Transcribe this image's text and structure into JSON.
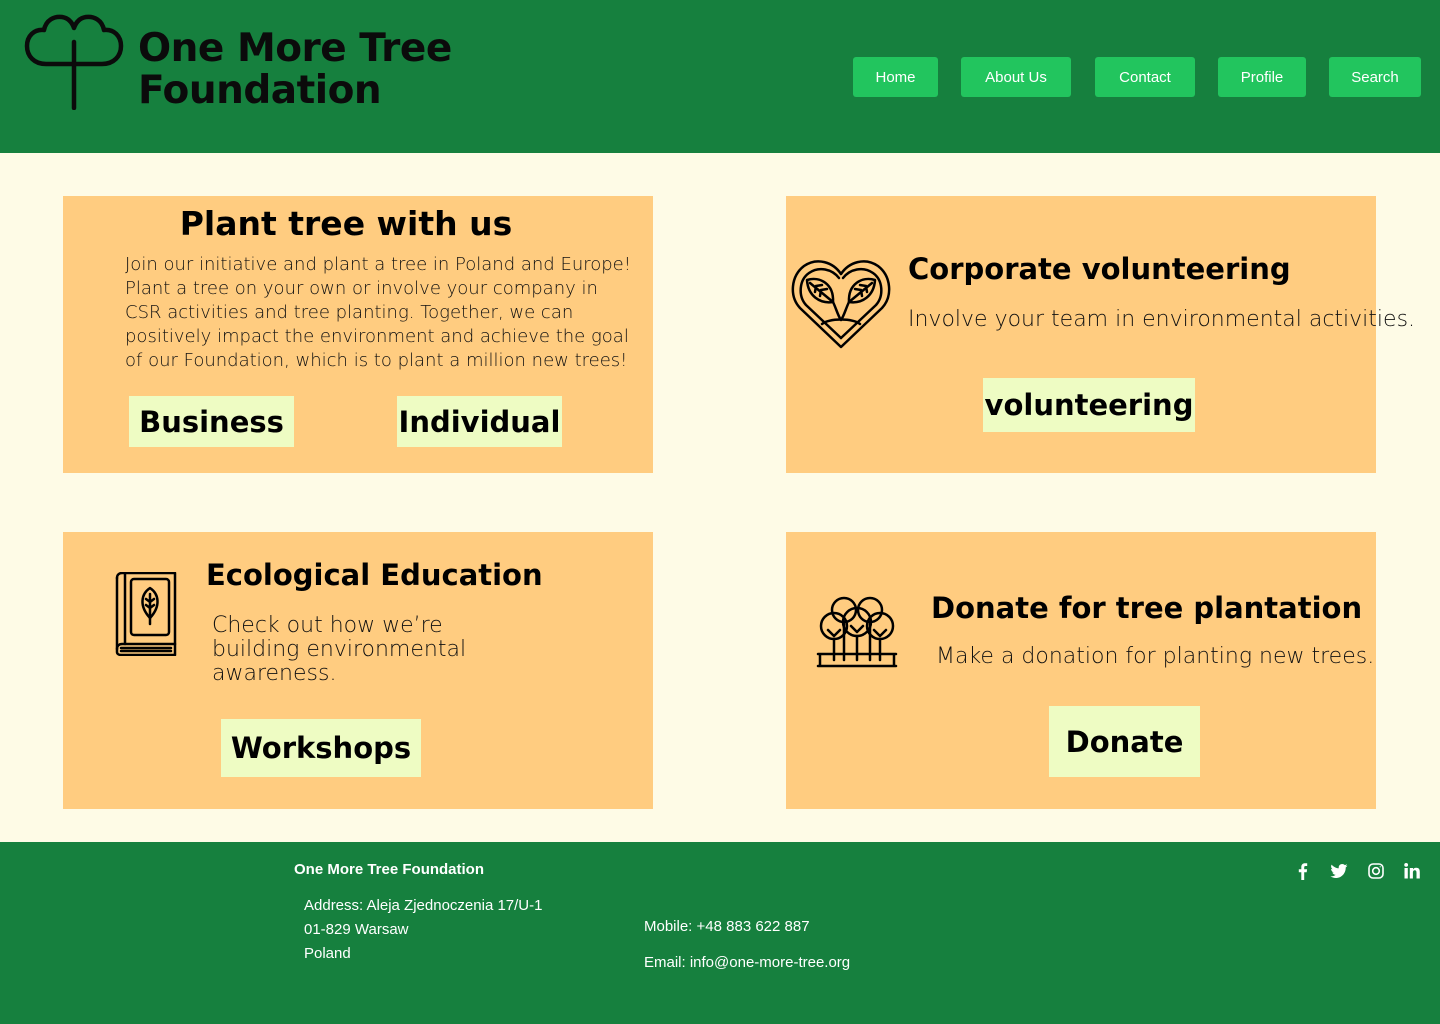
{
  "header": {
    "logo_line1": "One More Tree",
    "logo_line2": "Foundation",
    "nav": [
      {
        "label": "Home",
        "icon": ""
      },
      {
        "label": "About Us"
      },
      {
        "label": "Contact"
      },
      {
        "label": "Profile"
      },
      {
        "label": "Search"
      }
    ]
  },
  "cards": {
    "plant": {
      "title": "Plant tree with us",
      "text": "Join our initiative and plant a tree in Poland and Europe! Plant a tree on your own or involve your company in CSR activities and tree planting. Together, we can positively impact the environment and achieve the goal of our Foundation, which is to plant a million new trees!",
      "btn_business": "Business",
      "btn_individual": "Individual"
    },
    "volunteer": {
      "icon": "heart-leaves-icon",
      "title": "Corporate volunteering",
      "text": "Involve your team in environmental activities.",
      "button": "volunteering"
    },
    "education": {
      "icon": "leaf-book-icon",
      "title": "Ecological Education",
      "text": "Check out how we’re building environmental awareness.",
      "button": "Workshops"
    },
    "donate": {
      "icon": "trees-icon",
      "title": "Donate for tree plantation",
      "text": "Make a donation for planting new trees.",
      "button": "Donate"
    }
  },
  "footer": {
    "title": "One More Tree Foundation",
    "address_line1": "Address: Aleja Zjednoczenia 17/U-1",
    "address_line2": "01-829 Warsaw",
    "address_line3": "Poland",
    "mobile": "Mobile: +48 883 622 887",
    "email": "Email: info@one-more-tree.org",
    "social": [
      "facebook-icon",
      "twitter-icon",
      "instagram-icon",
      "linkedin-icon"
    ]
  },
  "colors": {
    "header_bg": "#16803E",
    "nav_button": "#22C55E",
    "page_bg": "#FEFBE6",
    "card_bg": "#FFCC80",
    "card_button": "#EEFCC3"
  }
}
